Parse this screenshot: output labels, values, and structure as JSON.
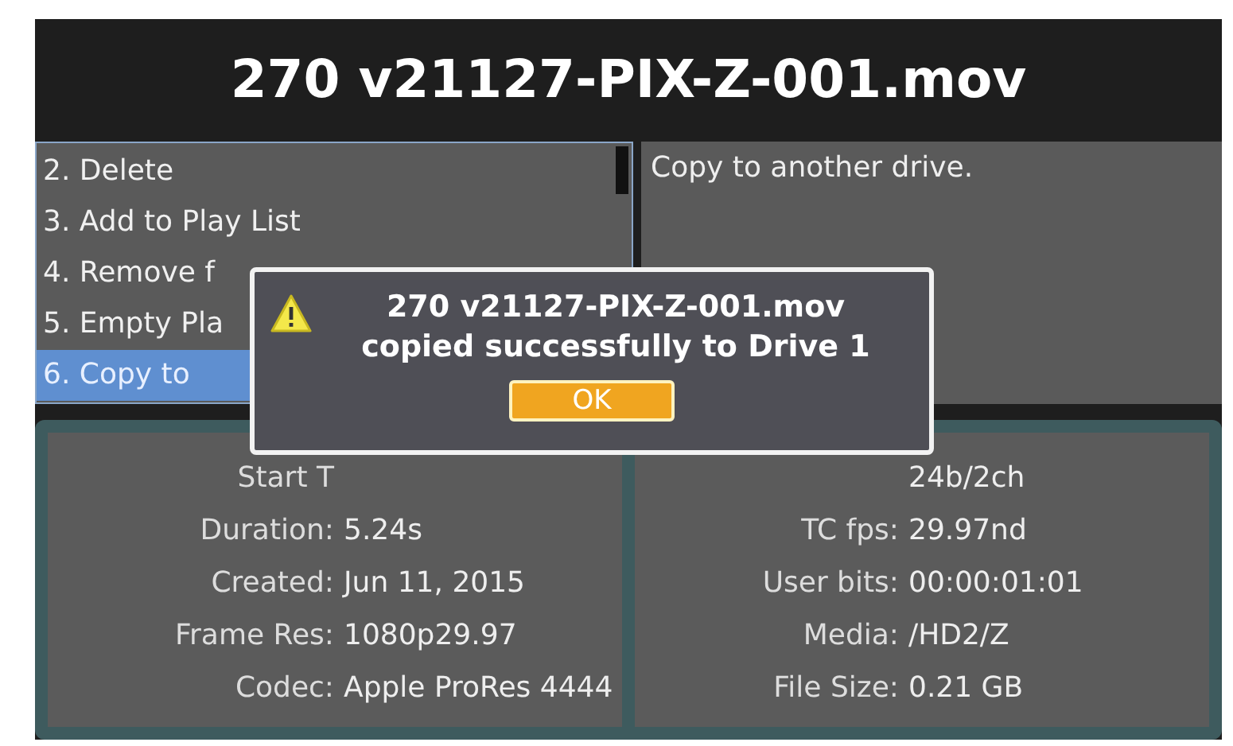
{
  "title": "270 v21127-PIX-Z-001.mov",
  "menu": [
    {
      "label": "2. Delete",
      "selected": false
    },
    {
      "label": "3. Add to Play List",
      "selected": false
    },
    {
      "label": "4. Remove f",
      "selected": false
    },
    {
      "label": "5. Empty Pla",
      "selected": false
    },
    {
      "label": "6. Copy to",
      "selected": true
    }
  ],
  "description": "Copy to another drive.",
  "info_left": [
    {
      "label": "Start T"
    },
    {
      "label": "Duration:",
      "value": "5.24s"
    },
    {
      "label": "Created:",
      "value": "Jun 11, 2015"
    },
    {
      "label": "Frame Res:",
      "value": "1080p29.97"
    },
    {
      "label": "Codec:",
      "value": "Apple ProRes 4444"
    }
  ],
  "info_right": [
    {
      "value": "24b/2ch"
    },
    {
      "label": "TC fps:",
      "value": "29.97nd"
    },
    {
      "label": "User bits:",
      "value": "00:00:01:01"
    },
    {
      "label": "Media:",
      "value": "/HD2/Z"
    },
    {
      "label": "File Size:",
      "value": "0.21 GB"
    }
  ],
  "dialog": {
    "lines": [
      "270 v21127-PIX-Z-001.mov",
      "copied successfully to Drive 1"
    ],
    "button": "OK"
  }
}
